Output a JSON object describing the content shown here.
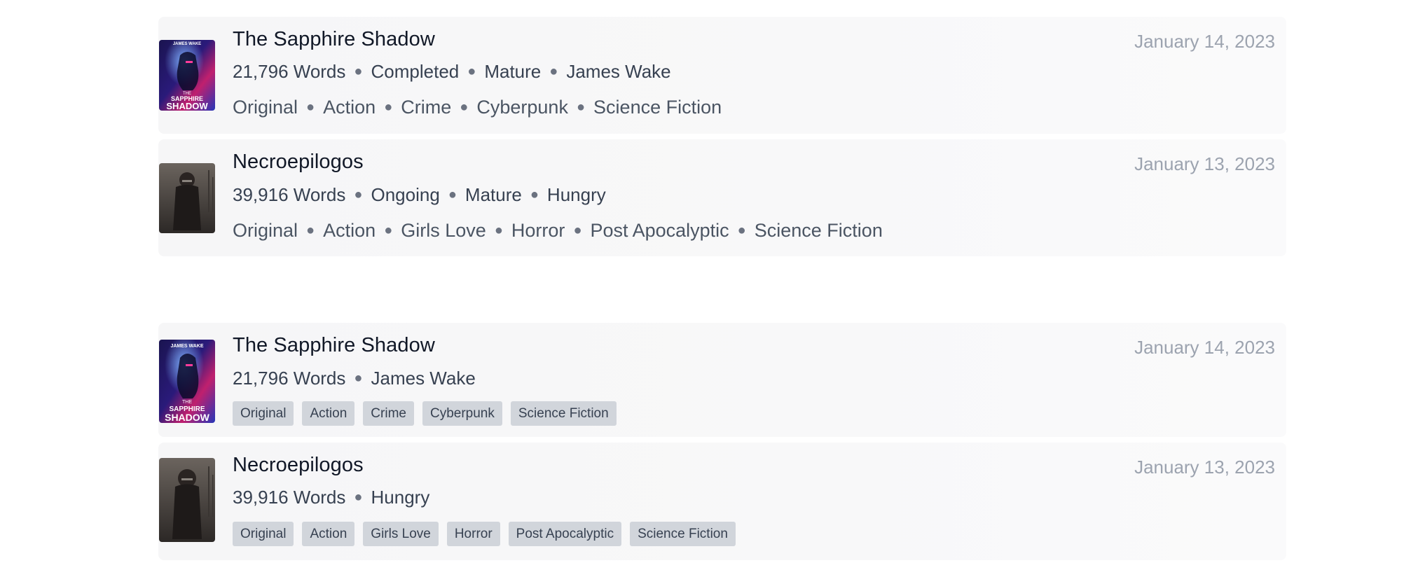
{
  "section_a": {
    "items": [
      {
        "title": "The Sapphire Shadow",
        "date": "January 14, 2023",
        "words": "21,796 Words",
        "status": "Completed",
        "rating": "Mature",
        "author": "James Wake",
        "cover_author": "JAMES WAKE",
        "cover_title_1": "THE",
        "cover_title_2": "SAPPHIRE",
        "cover_title_3": "SHADOW",
        "tags": [
          "Original",
          "Action",
          "Crime",
          "Cyberpunk",
          "Science Fiction"
        ]
      },
      {
        "title": "Necroepilogos",
        "date": "January 13, 2023",
        "words": "39,916 Words",
        "status": "Ongoing",
        "rating": "Mature",
        "author": "Hungry",
        "tags": [
          "Original",
          "Action",
          "Girls Love",
          "Horror",
          "Post Apocalyptic",
          "Science Fiction"
        ]
      }
    ]
  },
  "section_b": {
    "items": [
      {
        "title": "The Sapphire Shadow",
        "date": "January 14, 2023",
        "words": "21,796 Words",
        "author": "James Wake",
        "cover_author": "JAMES WAKE",
        "cover_title_1": "THE",
        "cover_title_2": "SAPPHIRE",
        "cover_title_3": "SHADOW",
        "tags": [
          "Original",
          "Action",
          "Crime",
          "Cyberpunk",
          "Science Fiction"
        ]
      },
      {
        "title": "Necroepilogos",
        "date": "January 13, 2023",
        "words": "39,916 Words",
        "author": "Hungry",
        "tags": [
          "Original",
          "Action",
          "Girls Love",
          "Horror",
          "Post Apocalyptic",
          "Science Fiction"
        ]
      }
    ]
  },
  "colors": {
    "card_bg": "#f7f7f8",
    "tag_chip_bg": "#d1d5db",
    "date_text": "#9ca3af"
  }
}
